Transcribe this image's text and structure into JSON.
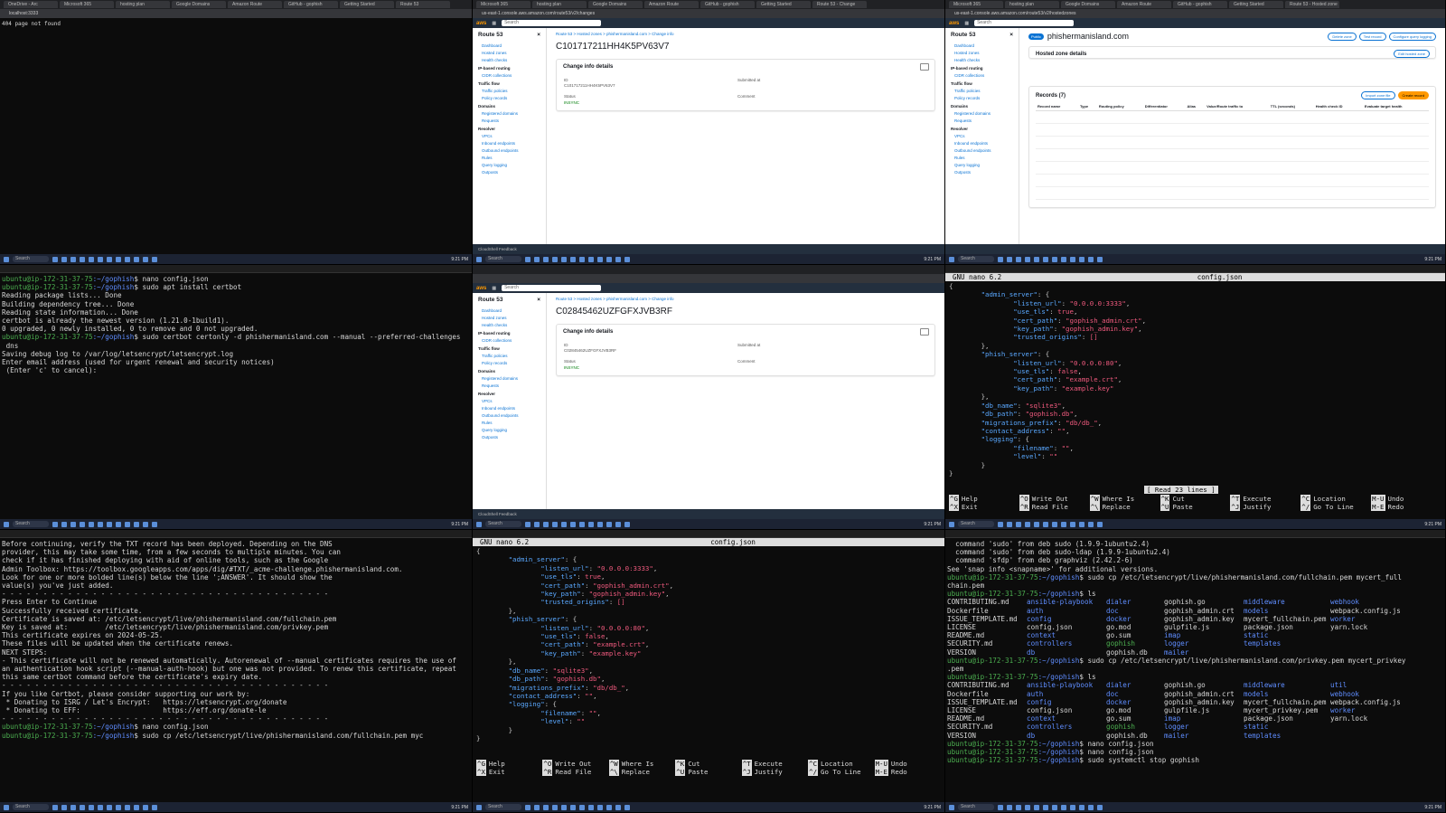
{
  "panes": {
    "p1": {
      "tabs": [
        "OneDrive - Arc",
        "Microsoft 365",
        "hosting plan",
        "Google Domains",
        "Amazon Route",
        "GitHub - gophish",
        "Getting Started",
        "Route 53"
      ],
      "url": "localhost:3333",
      "text": "404 page not found"
    },
    "p2": {
      "tabs": [
        "Microsoft 365",
        "hosting plan",
        "Google Domains",
        "Amazon Route",
        "GitHub - gophish",
        "Getting Started",
        "Route 53 - Change"
      ],
      "url": "us-east-1.console.aws.amazon.com/route53/v2/changes",
      "change_id": "C101717211HH4K5PV63V7",
      "search": "Search",
      "footer": "CloudShell   Feedback"
    },
    "p3": {
      "tabs": [
        "Microsoft 365",
        "hosting plan",
        "Google Domains",
        "Amazon Route",
        "GitHub - gophish",
        "Getting Started",
        "Route 53 - Hosted zone"
      ],
      "url": "us-east-1.console.aws.amazon.com/route53/v2/hostedzones",
      "zone": "phishermanisland.com",
      "zone_badge": "Public",
      "records_title": "Records (7)",
      "btn_delete": "Delete zone",
      "btn_test": "Test record",
      "btn_config": "Configure query logging",
      "btn_import": "Import zone file",
      "btn_create": "Create record",
      "details": "Hosted zone details",
      "edit_details": "Edit hosted zone",
      "cols": [
        "Record name",
        "Type",
        "Routing policy",
        "Differentiator",
        "Alias",
        "Value/Route traffic to",
        "TTL (seconds)",
        "Health check ID",
        "Evaluate target health"
      ]
    },
    "p4": {
      "winbar": "ubuntu@ip-172-31-37-75",
      "lines": [
        {
          "t": "prompt",
          "u": "ubuntu@ip-172-31-37-75",
          "pth": ":~/gophish",
          "c": "$ nano config.json"
        },
        {
          "t": "prompt",
          "u": "ubuntu@ip-172-31-37-75",
          "pth": ":~/gophish",
          "c": "$ sudo apt install certbot"
        },
        {
          "t": "out",
          "c": "Reading package lists... Done"
        },
        {
          "t": "out",
          "c": "Building dependency tree... Done"
        },
        {
          "t": "out",
          "c": "Reading state information... Done"
        },
        {
          "t": "out",
          "c": "certbot is already the newest version (1.21.0-1build1)."
        },
        {
          "t": "out",
          "c": "0 upgraded, 0 newly installed, 0 to remove and 0 not upgraded."
        },
        {
          "t": "prompt",
          "u": "ubuntu@ip-172-31-37-75",
          "pth": ":~/gophish",
          "c": "$ sudo certbot certonly -d phishermanisland.com --manual --preferred-challenges"
        },
        {
          "t": "out",
          "c": " dns"
        },
        {
          "t": "out",
          "c": "Saving debug log to /var/log/letsencrypt/letsencrypt.log"
        },
        {
          "t": "out",
          "c": "Enter email address (used for urgent renewal and security notices)"
        },
        {
          "t": "out",
          "c": " (Enter 'c' to cancel):"
        }
      ]
    },
    "p5": {
      "change_id": "C02845462UZFGFXJVB3RF",
      "search": "Search",
      "footer": "CloudShell   Feedback"
    },
    "p6": {
      "title": "config.json",
      "version": "GNU nano 6.2",
      "status": "[ Read 23 lines ]"
    },
    "p7": {
      "lines": [
        {
          "t": "out",
          "c": "Before continuing, verify the TXT record has been deployed. Depending on the DNS"
        },
        {
          "t": "out",
          "c": "provider, this may take some time, from a few seconds to multiple minutes. You can"
        },
        {
          "t": "out",
          "c": "check if it has finished deploying with aid of online tools, such as the Google"
        },
        {
          "t": "out",
          "c": "Admin Toolbox: https://toolbox.googleapps.com/apps/dig/#TXT/_acme-challenge.phishermanisland.com."
        },
        {
          "t": "out",
          "c": "Look for one or more bolded line(s) below the line ';ANSWER'. It should show the"
        },
        {
          "t": "out",
          "c": "value(s) you've just added."
        },
        {
          "t": "out",
          "c": ""
        },
        {
          "t": "out",
          "c": "- - - - - - - - - - - - - - - - - - - - - - - - - - - - - - - - - - - - - - - -"
        },
        {
          "t": "out",
          "c": "Press Enter to Continue"
        },
        {
          "t": "out",
          "c": ""
        },
        {
          "t": "out",
          "c": "Successfully received certificate."
        },
        {
          "t": "out",
          "c": "Certificate is saved at: /etc/letsencrypt/live/phishermanisland.com/fullchain.pem"
        },
        {
          "t": "out",
          "c": "Key is saved at:         /etc/letsencrypt/live/phishermanisland.com/privkey.pem"
        },
        {
          "t": "out",
          "c": "This certificate expires on 2024-05-25."
        },
        {
          "t": "out",
          "c": "These files will be updated when the certificate renews."
        },
        {
          "t": "out",
          "c": ""
        },
        {
          "t": "out",
          "c": "NEXT STEPS:"
        },
        {
          "t": "out",
          "c": "- This certificate will not be renewed automatically. Autorenewal of --manual certificates requires the use of"
        },
        {
          "t": "out",
          "c": "an authentication hook script (--manual-auth-hook) but one was not provided. To renew this certificate, repeat"
        },
        {
          "t": "out",
          "c": "this same certbot command before the certificate's expiry date."
        },
        {
          "t": "out",
          "c": ""
        },
        {
          "t": "out",
          "c": "- - - - - - - - - - - - - - - - - - - - - - - - - - - - - - - - - - - - - - - -"
        },
        {
          "t": "out",
          "c": "If you like Certbot, please consider supporting our work by:"
        },
        {
          "t": "out",
          "c": " * Donating to ISRG / Let's Encrypt:   https://letsencrypt.org/donate"
        },
        {
          "t": "out",
          "c": " * Donating to EFF:                    https://eff.org/donate-le"
        },
        {
          "t": "out",
          "c": "- - - - - - - - - - - - - - - - - - - - - - - - - - - - - - - - - - - - - - - -"
        },
        {
          "t": "prompt",
          "u": "ubuntu@ip-172-31-37-75",
          "pth": ":~/gophish",
          "c": "$ nano config.json"
        },
        {
          "t": "prompt",
          "u": "ubuntu@ip-172-31-37-75",
          "pth": ":~/gophish",
          "c": "$ sudo cp /etc/letsencrypt/live/phishermanisland.com/fullchain.pem myc"
        }
      ]
    },
    "p8": {
      "title": "config.json",
      "version": "GNU nano 6.2"
    },
    "p9": {
      "lines": [
        {
          "t": "out",
          "c": "  command 'sudo' from deb sudo (1.9.9-1ubuntu2.4)"
        },
        {
          "t": "out",
          "c": "  command 'sudo' from deb sudo-ldap (1.9.9-1ubuntu2.4)"
        },
        {
          "t": "out",
          "c": "  command 'sfdp' from deb graphviz (2.42.2-6)"
        },
        {
          "t": "out",
          "c": "See 'snap info <snapname>' for additional versions."
        },
        {
          "t": "prompt",
          "u": "ubuntu@ip-172-31-37-75",
          "pth": ":~/gophish",
          "c": "$ sudo cp /etc/letsencrypt/live/phishermanisland.com/fullchain.pem mycert_full"
        },
        {
          "t": "out",
          "c": "chain.pem"
        },
        {
          "t": "prompt",
          "u": "ubuntu@ip-172-31-37-75",
          "pth": ":~/gophish",
          "c": "$ ls"
        },
        {
          "t": "ls",
          "c": [
            [
              "CONTRIBUTING.md",
              ""
            ],
            [
              "ansible-playbook",
              "b"
            ],
            [
              "dialer",
              "b"
            ],
            [
              "gophish.go",
              ""
            ],
            [
              "middleware",
              "b"
            ],
            [
              "webhook",
              "b"
            ]
          ]
        },
        {
          "t": "ls",
          "c": [
            [
              "Dockerfile",
              ""
            ],
            [
              "auth",
              "b"
            ],
            [
              "doc",
              "b"
            ],
            [
              "gophish_admin.crt",
              ""
            ],
            [
              "models",
              "b"
            ],
            [
              "webpack.config.js",
              ""
            ]
          ]
        },
        {
          "t": "ls",
          "c": [
            [
              "ISSUE_TEMPLATE.md",
              ""
            ],
            [
              "config",
              "b"
            ],
            [
              "docker",
              "b"
            ],
            [
              "gophish_admin.key",
              ""
            ],
            [
              "mycert_fullchain.pem",
              ""
            ],
            [
              "worker",
              "b"
            ]
          ]
        },
        {
          "t": "ls",
          "c": [
            [
              "LICENSE",
              ""
            ],
            [
              "config.json",
              ""
            ],
            [
              "go.mod",
              ""
            ],
            [
              "gulpfile.js",
              ""
            ],
            [
              "package.json",
              ""
            ],
            [
              "yarn.lock",
              ""
            ]
          ]
        },
        {
          "t": "ls",
          "c": [
            [
              "README.md",
              ""
            ],
            [
              "context",
              "b"
            ],
            [
              "go.sum",
              ""
            ],
            [
              "imap",
              "b"
            ],
            [
              "static",
              "b"
            ],
            [
              "",
              ""
            ]
          ]
        },
        {
          "t": "ls",
          "c": [
            [
              "SECURITY.md",
              ""
            ],
            [
              "controllers",
              "b"
            ],
            [
              "gophish",
              "g"
            ],
            [
              "logger",
              "b"
            ],
            [
              "templates",
              "b"
            ],
            [
              "",
              ""
            ]
          ]
        },
        {
          "t": "ls",
          "c": [
            [
              "VERSION",
              ""
            ],
            [
              "db",
              "b"
            ],
            [
              "gophish.db",
              ""
            ],
            [
              "mailer",
              "b"
            ],
            [
              "",
              ""
            ],
            [
              "",
              ""
            ]
          ]
        },
        {
          "t": "prompt",
          "u": "ubuntu@ip-172-31-37-75",
          "pth": ":~/gophish",
          "c": "$ sudo cp /etc/letsencrypt/live/phishermanisland.com/privkey.pem mycert_privkey"
        },
        {
          "t": "out",
          "c": ".pem"
        },
        {
          "t": "prompt",
          "u": "ubuntu@ip-172-31-37-75",
          "pth": ":~/gophish",
          "c": "$ ls"
        },
        {
          "t": "ls",
          "c": [
            [
              "CONTRIBUTING.md",
              ""
            ],
            [
              "ansible-playbook",
              "b"
            ],
            [
              "dialer",
              "b"
            ],
            [
              "gophish.go",
              ""
            ],
            [
              "middleware",
              "b"
            ],
            [
              "util",
              "b"
            ]
          ]
        },
        {
          "t": "ls",
          "c": [
            [
              "Dockerfile",
              ""
            ],
            [
              "auth",
              "b"
            ],
            [
              "doc",
              "b"
            ],
            [
              "gophish_admin.crt",
              ""
            ],
            [
              "models",
              "b"
            ],
            [
              "webhook",
              "b"
            ]
          ]
        },
        {
          "t": "ls",
          "c": [
            [
              "ISSUE_TEMPLATE.md",
              ""
            ],
            [
              "config",
              "b"
            ],
            [
              "docker",
              "b"
            ],
            [
              "gophish_admin.key",
              ""
            ],
            [
              "mycert_fullchain.pem",
              ""
            ],
            [
              "webpack.config.js",
              ""
            ]
          ]
        },
        {
          "t": "ls",
          "c": [
            [
              "LICENSE",
              ""
            ],
            [
              "config.json",
              ""
            ],
            [
              "go.mod",
              ""
            ],
            [
              "gulpfile.js",
              ""
            ],
            [
              "mycert_privkey.pem",
              ""
            ],
            [
              "worker",
              "b"
            ]
          ]
        },
        {
          "t": "ls",
          "c": [
            [
              "README.md",
              ""
            ],
            [
              "context",
              "b"
            ],
            [
              "go.sum",
              ""
            ],
            [
              "imap",
              "b"
            ],
            [
              "package.json",
              ""
            ],
            [
              "yarn.lock",
              ""
            ]
          ]
        },
        {
          "t": "ls",
          "c": [
            [
              "SECURITY.md",
              ""
            ],
            [
              "controllers",
              "b"
            ],
            [
              "gophish",
              "g"
            ],
            [
              "logger",
              "b"
            ],
            [
              "static",
              "b"
            ],
            [
              "",
              ""
            ]
          ]
        },
        {
          "t": "ls",
          "c": [
            [
              "VERSION",
              ""
            ],
            [
              "db",
              "b"
            ],
            [
              "gophish.db",
              ""
            ],
            [
              "mailer",
              "b"
            ],
            [
              "templates",
              "b"
            ],
            [
              "",
              ""
            ]
          ]
        },
        {
          "t": "prompt",
          "u": "ubuntu@ip-172-31-37-75",
          "pth": ":~/gophish",
          "c": "$ nano config.json"
        },
        {
          "t": "prompt",
          "u": "ubuntu@ip-172-31-37-75",
          "pth": ":~/gophish",
          "c": "$ nano config.json"
        },
        {
          "t": "prompt",
          "u": "ubuntu@ip-172-31-37-75",
          "pth": ":~/gophish",
          "c": "$ sudo systemctl stop gophish"
        }
      ]
    }
  },
  "config_json": [
    [
      "{"
    ],
    [
      "        ",
      "\"admin_server\"",
      ": {"
    ],
    [
      "                ",
      "\"listen_url\"",
      ": ",
      "\"0.0.0.0:3333\"",
      ","
    ],
    [
      "                ",
      "\"use_tls\"",
      ": ",
      "true",
      ","
    ],
    [
      "                ",
      "\"cert_path\"",
      ": ",
      "\"gophish_admin.crt\"",
      ","
    ],
    [
      "                ",
      "\"key_path\"",
      ": ",
      "\"gophish_admin.key\"",
      ","
    ],
    [
      "                ",
      "\"trusted_origins\"",
      ": ",
      "[]"
    ],
    [
      "        },"
    ],
    [
      "        ",
      "\"phish_server\"",
      ": {"
    ],
    [
      "                ",
      "\"listen_url\"",
      ": ",
      "\"0.0.0.0:80\"",
      ","
    ],
    [
      "                ",
      "\"use_tls\"",
      ": ",
      "false",
      ","
    ],
    [
      "                ",
      "\"cert_path\"",
      ": ",
      "\"example.crt\"",
      ","
    ],
    [
      "                ",
      "\"key_path\"",
      ": ",
      "\"example.key\""
    ],
    [
      "        },"
    ],
    [
      "        ",
      "\"db_name\"",
      ": ",
      "\"sqlite3\"",
      ","
    ],
    [
      "        ",
      "\"db_path\"",
      ": ",
      "\"gophish.db\"",
      ","
    ],
    [
      "        ",
      "\"migrations_prefix\"",
      ": ",
      "\"db/db_\"",
      ","
    ],
    [
      "        ",
      "\"contact_address\"",
      ": ",
      "\"\"",
      ","
    ],
    [
      "        ",
      "\"logging\"",
      ": {"
    ],
    [
      "                ",
      "\"filename\"",
      ": ",
      "\"\"",
      ","
    ],
    [
      "                ",
      "\"level\"",
      ": ",
      "\"\""
    ],
    [
      "        }"
    ],
    [
      "}"
    ]
  ],
  "nano_shortcuts": [
    [
      "^G",
      "Help",
      "^X",
      "Exit"
    ],
    [
      "^O",
      "Write Out",
      "^R",
      "Read File"
    ],
    [
      "^W",
      "Where Is",
      "^\\",
      "Replace"
    ],
    [
      "^K",
      "Cut",
      "^U",
      "Paste"
    ],
    [
      "^T",
      "Execute",
      "^J",
      "Justify"
    ],
    [
      "^C",
      "Location",
      "^/",
      "Go To Line"
    ],
    [
      "M-U",
      "Undo",
      "M-E",
      "Redo"
    ]
  ],
  "r53_nav": {
    "title": "Route 53",
    "items": [
      "Dashboard",
      "Hosted zones",
      "Health checks"
    ],
    "group1": "IP-based routing",
    "group1_items": [
      "CIDR collections"
    ],
    "group2": "Traffic flow",
    "group2_items": [
      "Traffic policies",
      "Policy records"
    ],
    "group3": "Domains",
    "group3_items": [
      "Registered domains",
      "Requests"
    ],
    "group4": "Resolver",
    "group4_items": [
      "VPCs",
      "Inbound endpoints",
      "Outbound endpoints",
      "Rules",
      "Query logging",
      "Outposts"
    ]
  },
  "aws_labels": {
    "change_info": "Change info details",
    "id_label": "ID",
    "submitted_label": "Submitted at",
    "status_label": "Status",
    "comment_label": "Comment",
    "status_value": "INSYNC",
    "breadcrumb": "Route 53 > Hosted zones > phishermanisland.com > Change info"
  },
  "taskbar": {
    "search": "Search",
    "time": "9:21 PM"
  }
}
